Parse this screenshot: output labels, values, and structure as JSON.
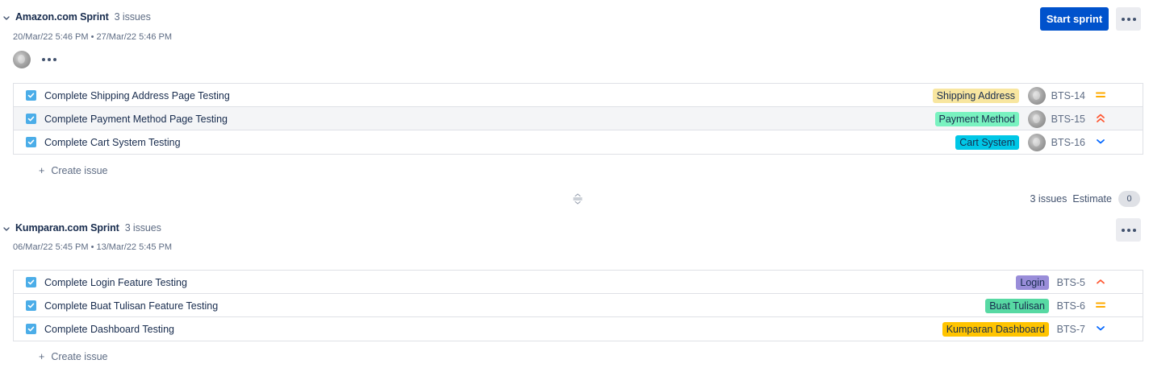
{
  "sprints": [
    {
      "name": "Amazon.com Sprint",
      "issue_count": "3 issues",
      "dates": "20/Mar/22 5:46 PM  •  27/Mar/22 5:46 PM",
      "start_label": "Start sprint",
      "issues": [
        {
          "summary": "Complete Shipping Address Page Testing",
          "epic": "Shipping Address",
          "epic_color": "#f8e6a0",
          "key": "BTS-14",
          "priority": "medium",
          "priority_color": "#ffab00"
        },
        {
          "summary": "Complete Payment Method Page Testing",
          "epic": "Payment Method",
          "epic_color": "#79f2c0",
          "key": "BTS-15",
          "priority": "highest",
          "priority_color": "#ff5630"
        },
        {
          "summary": "Complete Cart System Testing",
          "epic": "Cart System",
          "epic_color": "#00c7e6",
          "key": "BTS-16",
          "priority": "low",
          "priority_color": "#0065ff"
        }
      ],
      "create_label": "Create issue",
      "footer": {
        "issues": "3 issues",
        "estimate_label": "Estimate",
        "estimate_value": "0"
      }
    },
    {
      "name": "Kumparan.com Sprint",
      "issue_count": "3 issues",
      "dates": "06/Mar/22 5:45 PM  •  13/Mar/22 5:45 PM",
      "issues": [
        {
          "summary": "Complete Login Feature Testing",
          "epic": "Login",
          "epic_color": "#998dd9",
          "key": "BTS-5",
          "priority": "high",
          "priority_color": "#ff5630"
        },
        {
          "summary": "Complete Buat Tulisan Feature Testing",
          "epic": "Buat Tulisan",
          "epic_color": "#57d9a3",
          "key": "BTS-6",
          "priority": "medium",
          "priority_color": "#ffab00"
        },
        {
          "summary": "Complete Dashboard Testing",
          "epic": "Kumparan Dashboard",
          "epic_color": "#ffc400",
          "key": "BTS-7",
          "priority": "low",
          "priority_color": "#0065ff"
        }
      ],
      "create_label": "Create issue"
    }
  ],
  "icons": {
    "toggle": "chevron-down-icon",
    "issue_type": "task-checkbox-icon",
    "more": "more-horizontal-icon",
    "divider": "drag-handle-icon"
  }
}
